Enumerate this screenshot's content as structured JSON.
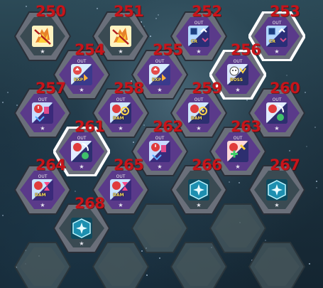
{
  "colors": {
    "number_text": "#c8141a",
    "hex_purple": "#5a3a8a",
    "hex_dark": "#3a4a52",
    "hex_empty": "#4a5a60",
    "highlight": "#ffffff"
  },
  "slots": [
    {
      "number": "250",
      "kind": "dark",
      "icon": "fire-weapon-icon",
      "label": "",
      "out": "",
      "selected": false
    },
    {
      "number": "251",
      "kind": "dark",
      "icon": "fire-weapon-icon",
      "label": "",
      "out": "",
      "selected": false
    },
    {
      "number": "252",
      "kind": "purple",
      "icon": "cr-boost-icon",
      "label": "CR",
      "out": "OUT",
      "selected": false
    },
    {
      "number": "253",
      "kind": "purple",
      "icon": "cr-boost-icon",
      "label": "CR",
      "out": "OUT",
      "selected": true
    },
    {
      "number": "254",
      "kind": "purple",
      "icon": "exp-boost-icon",
      "label": "EXP",
      "out": "OUT",
      "selected": false
    },
    {
      "number": "255",
      "kind": "purple",
      "icon": "exp-boost-icon",
      "label": "EXP",
      "out": "OUT",
      "selected": false
    },
    {
      "number": "256",
      "kind": "purple",
      "icon": "boss-damage-icon",
      "label": "BOSS",
      "out": "OUT",
      "selected": true
    },
    {
      "number": "257",
      "kind": "purple",
      "icon": "timer-defense-icon",
      "label": "",
      "out": "OUT",
      "selected": false
    },
    {
      "number": "258",
      "kind": "purple",
      "icon": "damage-target-icon",
      "label": "DAM",
      "out": "OUT",
      "selected": false
    },
    {
      "number": "259",
      "kind": "purple",
      "icon": "damage-target-icon",
      "label": "DAM",
      "out": "OUT",
      "selected": false
    },
    {
      "number": "260",
      "kind": "purple",
      "icon": "cooldown-swirl-icon",
      "label": "",
      "out": "OUT",
      "selected": false
    },
    {
      "number": "261",
      "kind": "purple",
      "icon": "cooldown-swirl-icon",
      "label": "",
      "out": "OUT",
      "selected": true
    },
    {
      "number": "262",
      "kind": "purple",
      "icon": "timer-defense-icon",
      "label": "",
      "out": "OUT",
      "selected": false
    },
    {
      "number": "263",
      "kind": "purple",
      "icon": "heal-plus-icon",
      "label": "",
      "out": "OUT",
      "selected": false
    },
    {
      "number": "264",
      "kind": "purple",
      "icon": "hourglass-damage-icon",
      "label": "DAM",
      "out": "OUT",
      "selected": false
    },
    {
      "number": "265",
      "kind": "purple",
      "icon": "hourglass-damage-icon",
      "label": "DAM",
      "out": "OUT",
      "selected": false
    },
    {
      "number": "266",
      "kind": "dark",
      "icon": "crystal-core-icon",
      "label": "",
      "out": "",
      "selected": false
    },
    {
      "number": "267",
      "kind": "dark",
      "icon": "crystal-core-icon",
      "label": "",
      "out": "",
      "selected": false
    },
    {
      "number": "268",
      "kind": "dark",
      "icon": "crystal-core-icon",
      "label": "",
      "out": "",
      "selected": false
    }
  ],
  "empty_slots": 6
}
